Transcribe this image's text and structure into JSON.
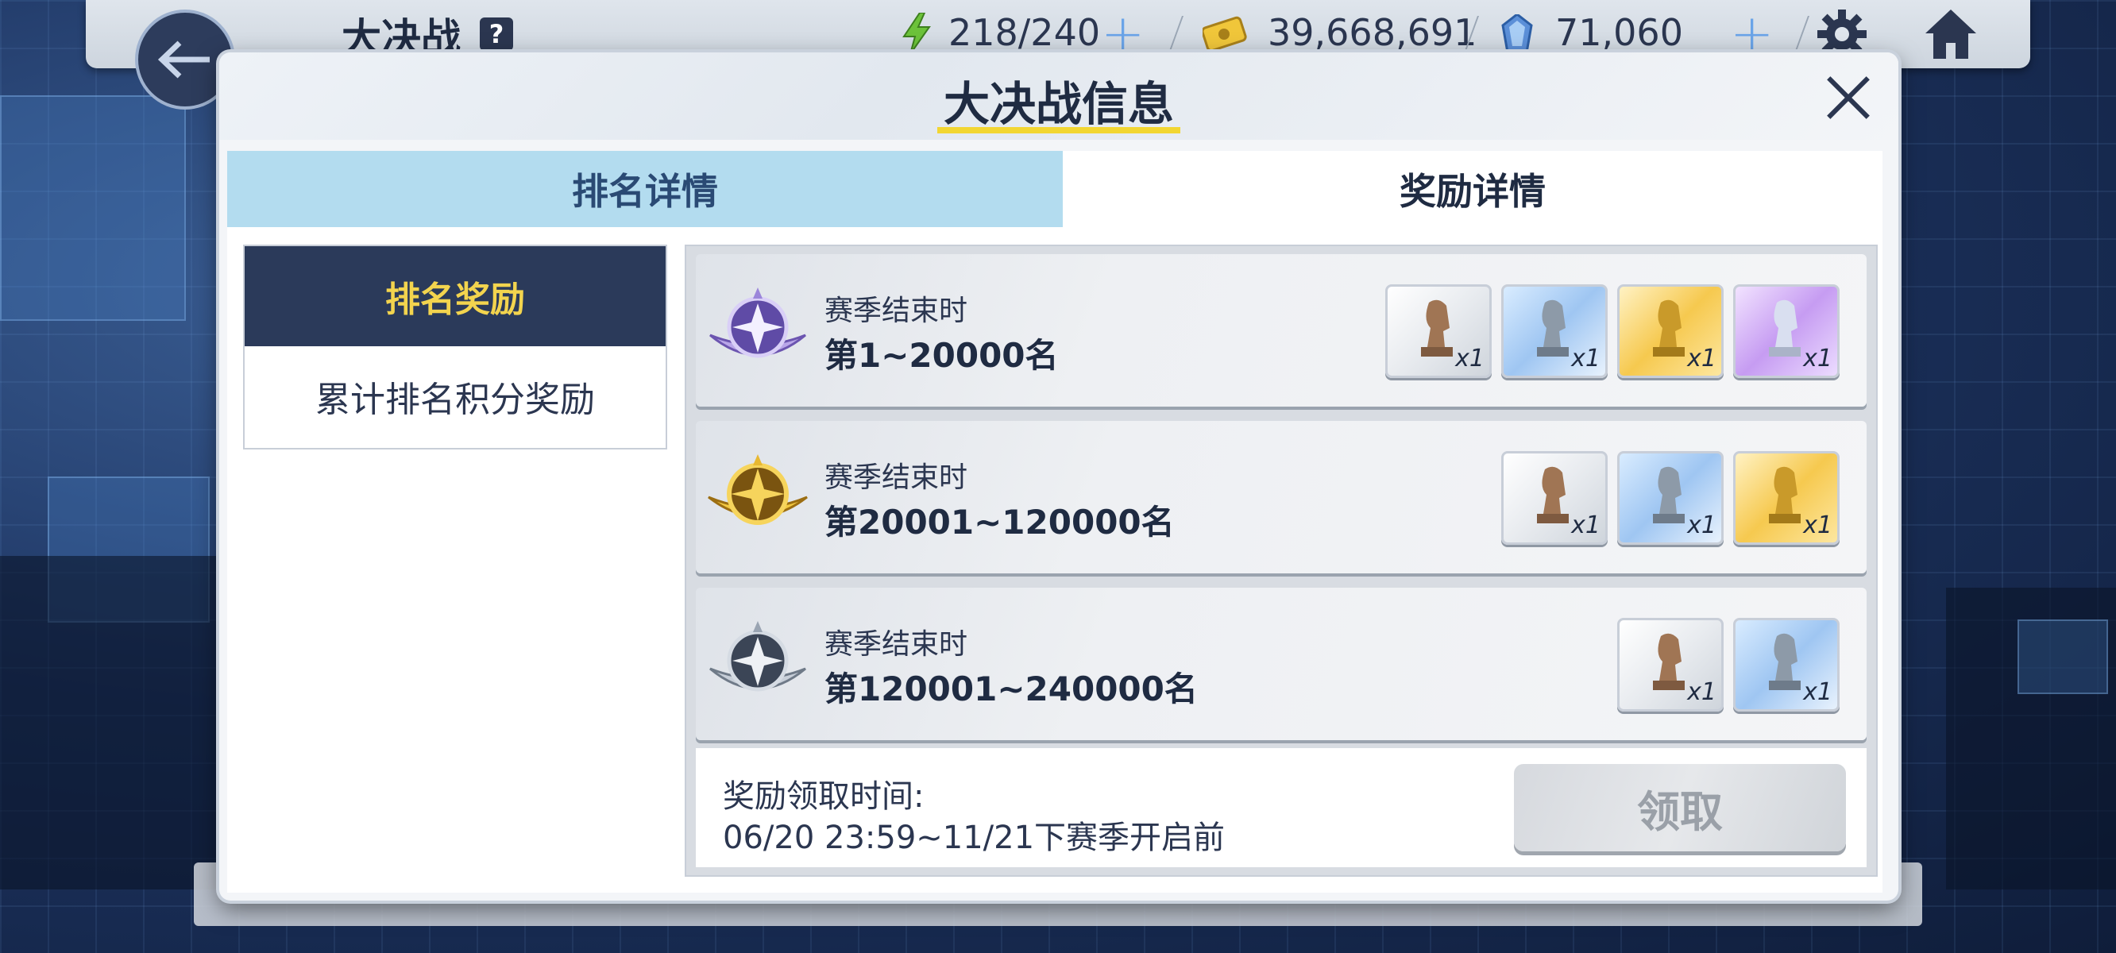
{
  "topbar": {
    "title": "大决战",
    "help": "?",
    "stamina": "218/240",
    "gold": "39,668,691",
    "gems": "71,060"
  },
  "modal": {
    "title": "大决战信息",
    "tabs": [
      {
        "label": "排名详情"
      },
      {
        "label": "奖励详情"
      }
    ],
    "side_menu": [
      {
        "label": "排名奖励"
      },
      {
        "label": "累计排名积分奖励"
      }
    ],
    "rows": [
      {
        "label": "赛季结束时",
        "range": "第1~20000名",
        "medal": "purple",
        "items": [
          {
            "type": "bronze",
            "qty": "x1"
          },
          {
            "type": "silver",
            "qty": "x1"
          },
          {
            "type": "gold",
            "qty": "x1"
          },
          {
            "type": "purple",
            "qty": "x1"
          }
        ]
      },
      {
        "label": "赛季结束时",
        "range": "第20001~120000名",
        "medal": "gold",
        "items": [
          {
            "type": "bronze",
            "qty": "x1"
          },
          {
            "type": "silver",
            "qty": "x1"
          },
          {
            "type": "gold",
            "qty": "x1"
          }
        ]
      },
      {
        "label": "赛季结束时",
        "range": "第120001~240000名",
        "medal": "silver",
        "items": [
          {
            "type": "bronze",
            "qty": "x1"
          },
          {
            "type": "silver",
            "qty": "x1"
          }
        ]
      }
    ],
    "footer": {
      "label": "奖励领取时间:",
      "time": "06/20 23:59~11/21下赛季开启前",
      "claim": "领取"
    }
  },
  "colors": {
    "accent": "#f2d632",
    "tab_active_bg": "#b3dcef",
    "menu_active_bg": "#2b3a5a",
    "menu_active_text": "#f3d44e"
  }
}
